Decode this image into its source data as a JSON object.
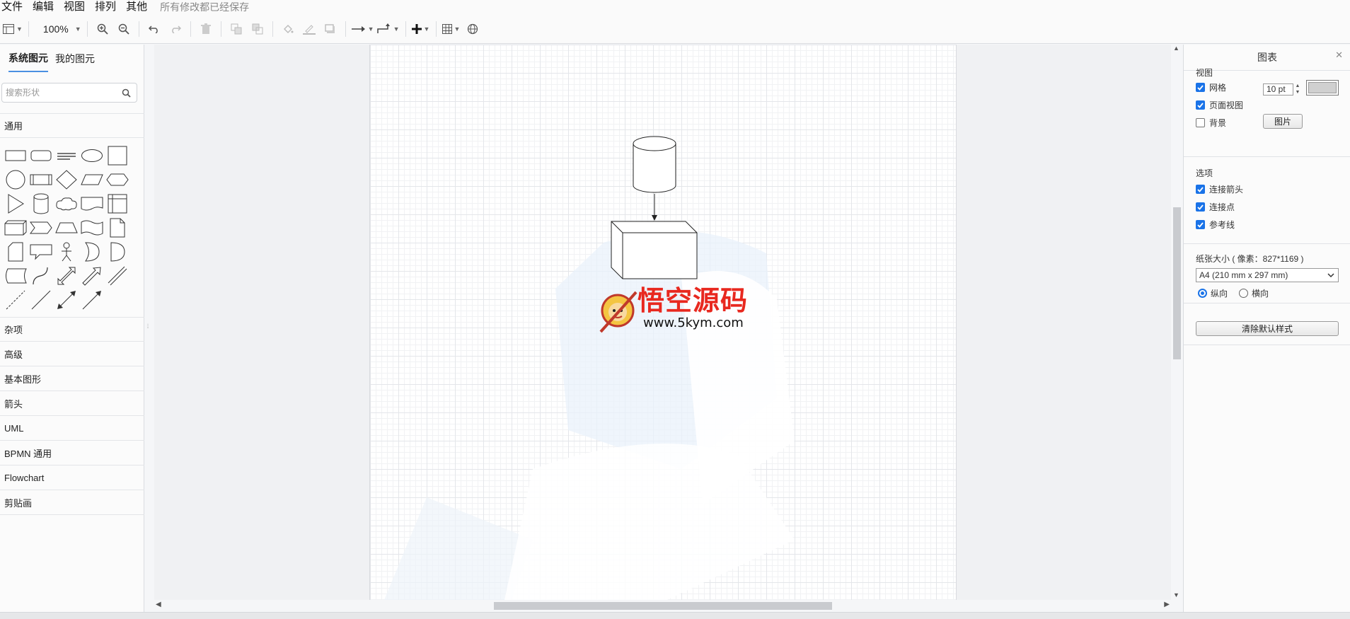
{
  "menubar": {
    "items": [
      "文件",
      "编辑",
      "视图",
      "排列",
      "其他"
    ],
    "status": "所有修改都已经保存"
  },
  "toolbar": {
    "zoom": "100%",
    "icons": [
      "panels-icon",
      "zoom-in-icon",
      "zoom-out-icon",
      "undo-icon",
      "redo-icon",
      "delete-icon",
      "to-front-icon",
      "to-back-icon",
      "fill-color-icon",
      "line-color-icon",
      "shadow-icon",
      "connection-icon",
      "waypoints-icon",
      "insert-icon",
      "table-icon",
      "language-icon"
    ]
  },
  "sidebar": {
    "tabs": [
      "系统图元",
      "我的图元"
    ],
    "active_tab": 0,
    "search_placeholder": "搜索形状",
    "open_category": "通用",
    "categories": [
      "杂项",
      "高级",
      "基本图形",
      "箭头",
      "UML",
      "BPMN 通用",
      "Flowchart",
      "剪贴画"
    ],
    "shapes": [
      [
        "rectangle",
        "rounded-rectangle",
        "text",
        "ellipse",
        "square"
      ],
      [
        "circle",
        "process",
        "diamond",
        "parallelogram",
        "hexagon"
      ],
      [
        "triangle",
        "cylinder",
        "cloud",
        "document",
        "internal-storage"
      ],
      [
        "cube",
        "step",
        "trapezoid",
        "tape",
        "note"
      ],
      [
        "card",
        "callout",
        "actor",
        "or",
        "and"
      ],
      [
        "data-storage",
        "curve",
        "bidirectional-arrow",
        "arrow",
        "link"
      ],
      [
        "dashed-line",
        "line",
        "bidirectional-connector",
        "directional-connector"
      ]
    ]
  },
  "canvas": {
    "watermark_title": "悟空源码",
    "watermark_url": "www.5kym.com"
  },
  "panel": {
    "title": "图表",
    "view": {
      "title": "视图",
      "grid_label": "网格",
      "grid_checked": true,
      "grid_size": "10 pt",
      "grid_color": "#d0d0d0",
      "page_view_label": "页面视图",
      "page_view_checked": true,
      "background_label": "背景",
      "background_checked": false,
      "image_button": "图片"
    },
    "options": {
      "title": "选项",
      "connection_arrows_label": "连接箭头",
      "connection_arrows_checked": true,
      "connection_points_label": "连接点",
      "connection_points_checked": true,
      "guides_label": "参考线",
      "guides_checked": true
    },
    "paper": {
      "title": "纸张大小 ( 像素：827*1169 )",
      "size": "A4 (210 mm x 297 mm)",
      "portrait_label": "纵向",
      "portrait_selected": true,
      "landscape_label": "横向",
      "landscape_selected": false
    },
    "reset_button": "清除默认样式"
  }
}
